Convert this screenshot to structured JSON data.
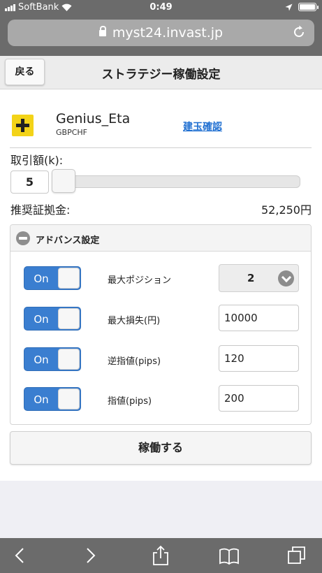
{
  "status_bar": {
    "carrier": "SoftBank",
    "time": "0:49"
  },
  "browser": {
    "url": "myst24.invast.jp"
  },
  "header": {
    "back_label": "戻る",
    "title": "ストラテジー稼働設定"
  },
  "strategy": {
    "name": "Genius_Eta",
    "pair": "GBPCHF",
    "position_link": "建玉確認"
  },
  "amount": {
    "label": "取引額(k):",
    "value": "5",
    "slider_fraction": 0.0
  },
  "margin": {
    "label": "推奨証拠金:",
    "value": "52,250円"
  },
  "advanced": {
    "title": "アドバンス設定",
    "rows": [
      {
        "toggle": "On",
        "label": "最大ポジション",
        "value": "2",
        "kind": "select"
      },
      {
        "toggle": "On",
        "label": "最大損失(円)",
        "value": "10000",
        "kind": "input"
      },
      {
        "toggle": "On",
        "label": "逆指値(pips)",
        "value": "120",
        "kind": "input"
      },
      {
        "toggle": "On",
        "label": "指値(pips)",
        "value": "200",
        "kind": "input"
      }
    ]
  },
  "run_button": "稼働する",
  "colors": {
    "toggle_on": "#3a7ed0",
    "link": "#1f6fd1",
    "plus_icon": "#f3d318",
    "browser_chrome": "#6b6b6b"
  }
}
